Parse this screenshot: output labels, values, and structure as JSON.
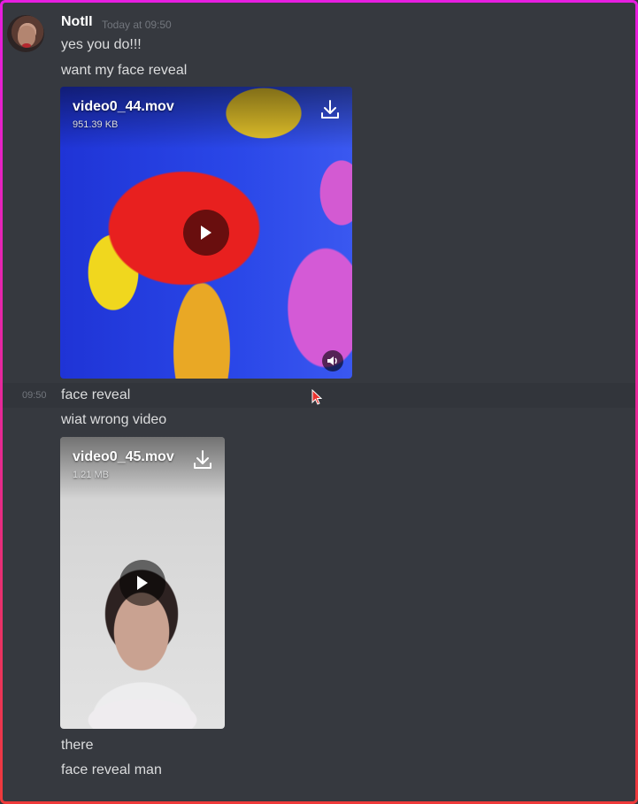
{
  "message": {
    "author": "NotII",
    "timestamp": "Today at 09:50",
    "lines": {
      "line1": "yes you do!!!",
      "line2": "want my face reveal",
      "line3": "face reveal",
      "line4": "wiat wrong video",
      "line5": "there",
      "line6": "face reveal man"
    },
    "hover_time": "09:50"
  },
  "attachments": [
    {
      "filename": "video0_44.mov",
      "size": "951.39 KB"
    },
    {
      "filename": "video0_45.mov",
      "size": "1.21 MB"
    }
  ],
  "icons": {
    "download": "download-icon",
    "play": "play-icon",
    "volume": "volume-icon",
    "cursor": "mouse-cursor-icon"
  },
  "colors": {
    "background": "#36393f",
    "text": "#dcddde",
    "muted": "#72767d",
    "frame_top": "#e61ee0",
    "frame_bottom": "#ee3a3a"
  }
}
